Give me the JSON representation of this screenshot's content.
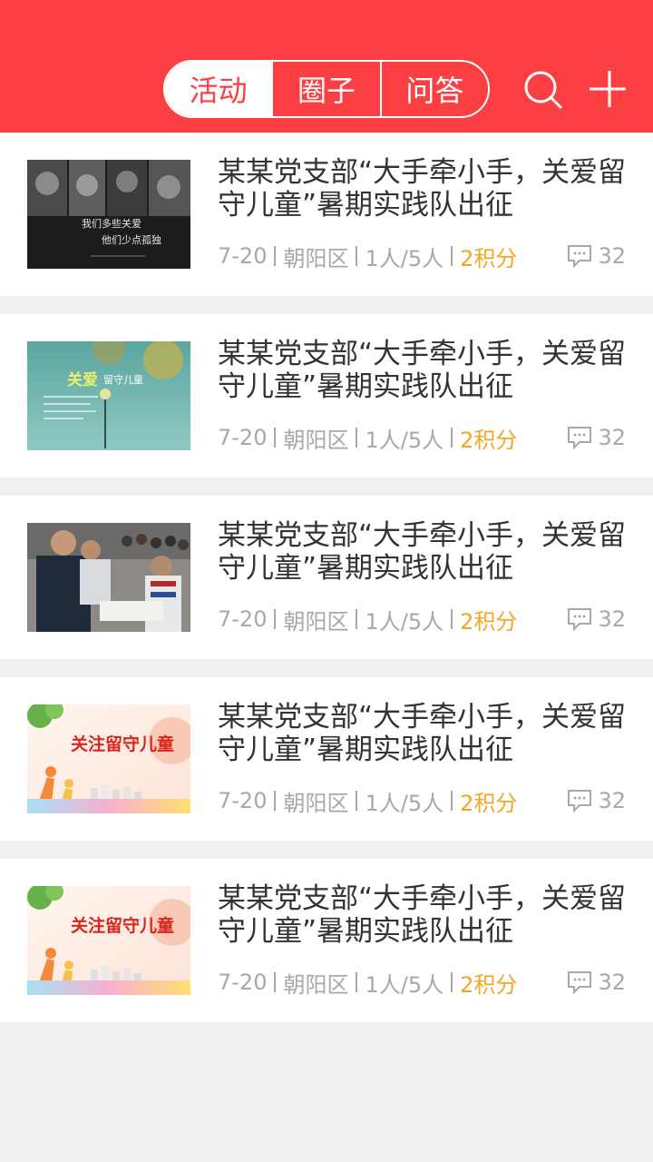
{
  "header": {
    "tabs": [
      {
        "label": "活动",
        "active": true
      },
      {
        "label": "圈子",
        "active": false
      },
      {
        "label": "问答",
        "active": false
      }
    ],
    "search_icon": "search-icon",
    "add_icon": "plus-icon",
    "bg_color": "#fc3f42"
  },
  "activities": [
    {
      "title": "某某党支部“大手牵小手，关爱留守儿童”暑期实践队出征",
      "date": "7-20",
      "district": "朝阳区",
      "participants": "1人/5人",
      "points": "2积分",
      "comments": "32",
      "thumb_text": [
        "我们多些关爱",
        "他们少点孤独"
      ]
    },
    {
      "title": "某某党支部“大手牵小手，关爱留守儿童”暑期实践队出征",
      "date": "7-20",
      "district": "朝阳区",
      "participants": "1人/5人",
      "points": "2积分",
      "comments": "32",
      "thumb_text": [
        "关爱",
        "留守儿童"
      ]
    },
    {
      "title": "某某党支部“大手牵小手，关爱留守儿童”暑期实践队出征",
      "date": "7-20",
      "district": "朝阳区",
      "participants": "1人/5人",
      "points": "2积分",
      "comments": "32",
      "thumb_text": []
    },
    {
      "title": "某某党支部“大手牵小手，关爱留守儿童”暑期实践队出征",
      "date": "7-20",
      "district": "朝阳区",
      "participants": "1人/5人",
      "points": "2积分",
      "comments": "32",
      "thumb_text": [
        "关注留守儿童"
      ]
    },
    {
      "title": "某某党支部“大手牵小手，关爱留守儿童”暑期实践队出征",
      "date": "7-20",
      "district": "朝阳区",
      "participants": "1人/5人",
      "points": "2积分",
      "comments": "32",
      "thumb_text": [
        "关注留守儿童"
      ]
    }
  ],
  "colors": {
    "accent": "#fc3f42",
    "points": "#f5a623",
    "meta": "#a8a8a8",
    "title": "#333333"
  }
}
